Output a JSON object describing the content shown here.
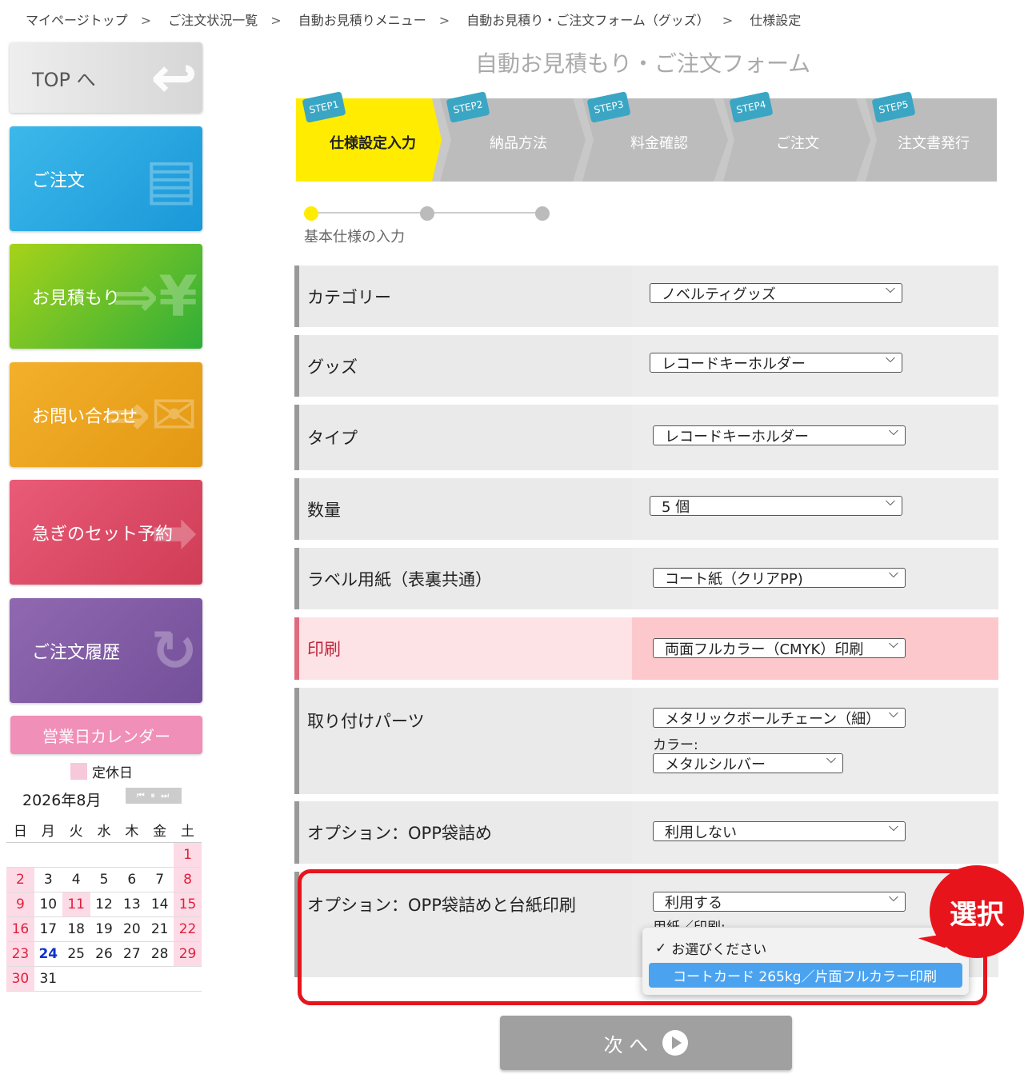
{
  "breadcrumb": [
    "マイページトップ",
    "ご注文状況一覧",
    "自動お見積りメニュー",
    "自動お見積り・ご注文フォーム（グッズ）",
    "仕様設定"
  ],
  "breadcrumb_sep": ">",
  "sidebar": {
    "top": "TOP へ",
    "order": "ご注文",
    "estimate": "お見積もり",
    "inquiry": "お問い合わせ",
    "rush": "急ぎのセット予約",
    "history": "ご注文履歴",
    "calendar_button": "営業日カレンダー"
  },
  "calendar": {
    "legend": "定休日",
    "month": "2026年8月",
    "nav": "⏮ ⏸ ⏭",
    "weekdays": [
      "日",
      "月",
      "火",
      "水",
      "木",
      "金",
      "土"
    ],
    "today": 24
  },
  "page_title": "自動お見積もり・ご注文フォーム",
  "steps": [
    {
      "tag": "STEP1",
      "name": "仕様設定入力"
    },
    {
      "tag": "STEP2",
      "name": "納品方法"
    },
    {
      "tag": "STEP3",
      "name": "料金確認"
    },
    {
      "tag": "STEP4",
      "name": "ご注文"
    },
    {
      "tag": "STEP5",
      "name": "注文書発行"
    }
  ],
  "progress_label": "基本仕様の入力",
  "form": {
    "category": {
      "label": "カテゴリー",
      "value": "ノベルティグッズ"
    },
    "goods": {
      "label": "グッズ",
      "value": "レコードキーホルダー"
    },
    "type": {
      "label": "タイプ",
      "value": "レコードキーホルダー"
    },
    "quantity": {
      "label": "数量",
      "value": "5 個"
    },
    "label_paper": {
      "label": "ラベル用紙（表裏共通）",
      "value": "コート紙（クリアPP)"
    },
    "print": {
      "label": "印刷",
      "value": "両面フルカラー（CMYK）印刷"
    },
    "parts": {
      "label": "取り付けパーツ",
      "value": "メタリックボールチェーン（細）",
      "color_label": "カラー:",
      "color_value": "メタルシルバー"
    },
    "opp": {
      "label": "オプション：OPP袋詰め",
      "value": "利用しない"
    },
    "opp_print": {
      "label": "オプション：OPP袋詰めと台紙印刷",
      "value": "利用する",
      "paper_label": "用紙／印刷:"
    }
  },
  "dropdown": {
    "options": [
      "お選びください",
      "コートカード 265kg／片面フルカラー印刷"
    ],
    "checked_index": 0,
    "highlighted_index": 1
  },
  "callout": "選択",
  "next_button": "次 へ",
  "colors": {
    "active_step": "#ffec00",
    "highlight": "#e8141c",
    "option_highlight": "#4ba3f0"
  }
}
